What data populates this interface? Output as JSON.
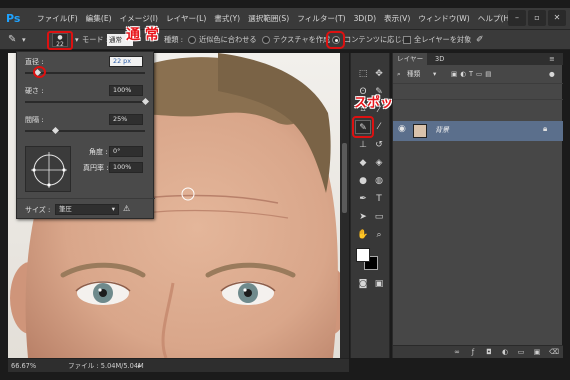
{
  "app": {
    "logo": "Ps",
    "menu": [
      "ファイル(F)",
      "編集(E)",
      "イメージ(I)",
      "レイヤー(L)",
      "書式(Y)",
      "選択範囲(S)",
      "フィルター(T)",
      "3D(D)",
      "表示(V)",
      "ウィンドウ(W)",
      "ヘルプ(H)"
    ]
  },
  "options": {
    "brush_size_chip": "22",
    "mode_label": "モード :",
    "mode_value": "通常",
    "type_label": "種類 :",
    "radio1": "近似色に合わせる",
    "radio2": "テクスチャを作成",
    "radio3": "コンテンツに応じる",
    "checkbox": "全レイヤーを対象"
  },
  "annotations": {
    "mode_note": "通 常",
    "tool_note": "スポット修復ブラシ"
  },
  "brush_panel": {
    "diameter_label": "直径 :",
    "diameter_value": "22 px",
    "hardness_label": "硬さ :",
    "hardness_value": "100%",
    "spacing_label": "間隔 :",
    "spacing_value": "25%",
    "angle_label": "角度 :",
    "angle_value": "0°",
    "roundness_label": "真円率 :",
    "roundness_value": "100%",
    "size_label": "サイズ :",
    "size_value": "筆圧",
    "diameter_fraction": 0.1,
    "hardness_fraction": 1.0,
    "spacing_fraction": 0.25
  },
  "status": {
    "zoom": "66.67%",
    "file_info": "ファイル : 5.04M/5.04M"
  },
  "layers_panel": {
    "tab_layers": "レイヤー",
    "tab_3d": "3D",
    "kind_filter": "種類",
    "layer_name": "背景"
  },
  "colors": {
    "accent_red": "#e8151b",
    "ps_blue": "#1fa3ff",
    "layer_selected": "#5b6f8c"
  }
}
